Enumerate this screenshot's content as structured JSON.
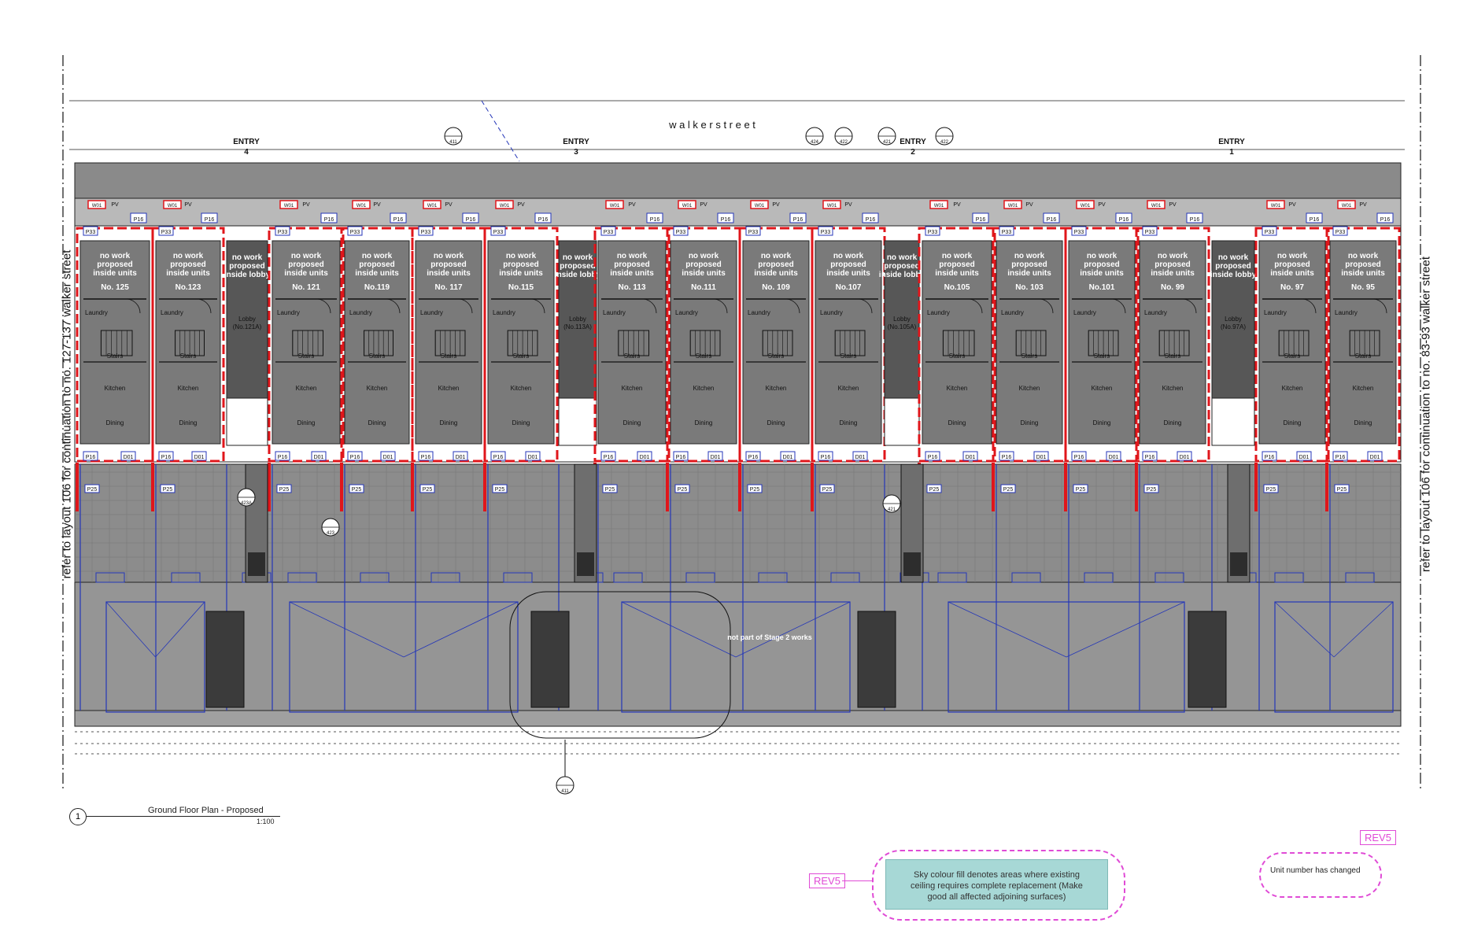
{
  "street_name": "w a l k e r   s t r e e t",
  "entries": [
    {
      "label": "ENTRY",
      "num": "4"
    },
    {
      "label": "ENTRY",
      "num": "3"
    },
    {
      "label": "ENTRY",
      "num": "2"
    },
    {
      "label": "ENTRY",
      "num": "1"
    }
  ],
  "units": [
    {
      "no": "No. 125",
      "type": "unit"
    },
    {
      "no": "No.123",
      "type": "unit"
    },
    {
      "no": "Lobby (No.121A)",
      "type": "lobby"
    },
    {
      "no": "No. 121",
      "type": "unit"
    },
    {
      "no": "No.119",
      "type": "unit"
    },
    {
      "no": "No. 117",
      "type": "unit"
    },
    {
      "no": "No.115",
      "type": "unit"
    },
    {
      "no": "Lobby (No.113A)",
      "type": "lobby"
    },
    {
      "no": "No. 113",
      "type": "unit"
    },
    {
      "no": "No.111",
      "type": "unit"
    },
    {
      "no": "No. 109",
      "type": "unit"
    },
    {
      "no": "No.107",
      "type": "unit"
    },
    {
      "no": "Lobby (No.105A)",
      "type": "lobby"
    },
    {
      "no": "No.105",
      "type": "unit"
    },
    {
      "no": "No. 103",
      "type": "unit"
    },
    {
      "no": "No.101",
      "type": "unit"
    },
    {
      "no": "No. 99",
      "type": "unit"
    },
    {
      "no": "Lobby (No.97A)",
      "type": "lobby"
    },
    {
      "no": "No. 97",
      "type": "unit"
    },
    {
      "no": "No. 95",
      "type": "unit"
    }
  ],
  "unit_note": [
    "no work",
    "proposed",
    "inside units"
  ],
  "lobby_note": [
    "no work",
    "proposed",
    "inside lobby"
  ],
  "room_labels": {
    "laundry": "Laundry",
    "stairs": "Stairs",
    "kitchen": "Kitchen",
    "dining": "Dining"
  },
  "tags": {
    "p16": "P16",
    "p33": "P33",
    "w01": "W01",
    "d01": "D01",
    "p25": "P25",
    "pv": "PV"
  },
  "section_markers": [
    "424",
    "422",
    "421",
    "422",
    "411",
    "423A",
    "423",
    "421",
    "411"
  ],
  "not_part_note": "not part of Stage 2 works",
  "side_left": "refer to layout 106 for continuation to no. 127-137 walker street",
  "side_right": "refer to layout 106 for continuation to no. 83-93 walker street",
  "drawing_title": "Ground Floor Plan - Proposed",
  "drawing_scale": "1:100",
  "drawing_number": "1",
  "rev_label_1": "REV5",
  "rev_label_2": "REV5",
  "sky_note": "Sky colour fill denotes areas where existing ceiling requires complete replacement (Make good all affected adjoining surfaces)",
  "unit_changed_note": "Unit number has changed",
  "colors": {
    "red": "#e0161b",
    "blue": "#2436b8",
    "grey": "#7a7a7a",
    "dark": "#575757",
    "pink": "#e04bd6",
    "sky": "#a7d8d6"
  }
}
